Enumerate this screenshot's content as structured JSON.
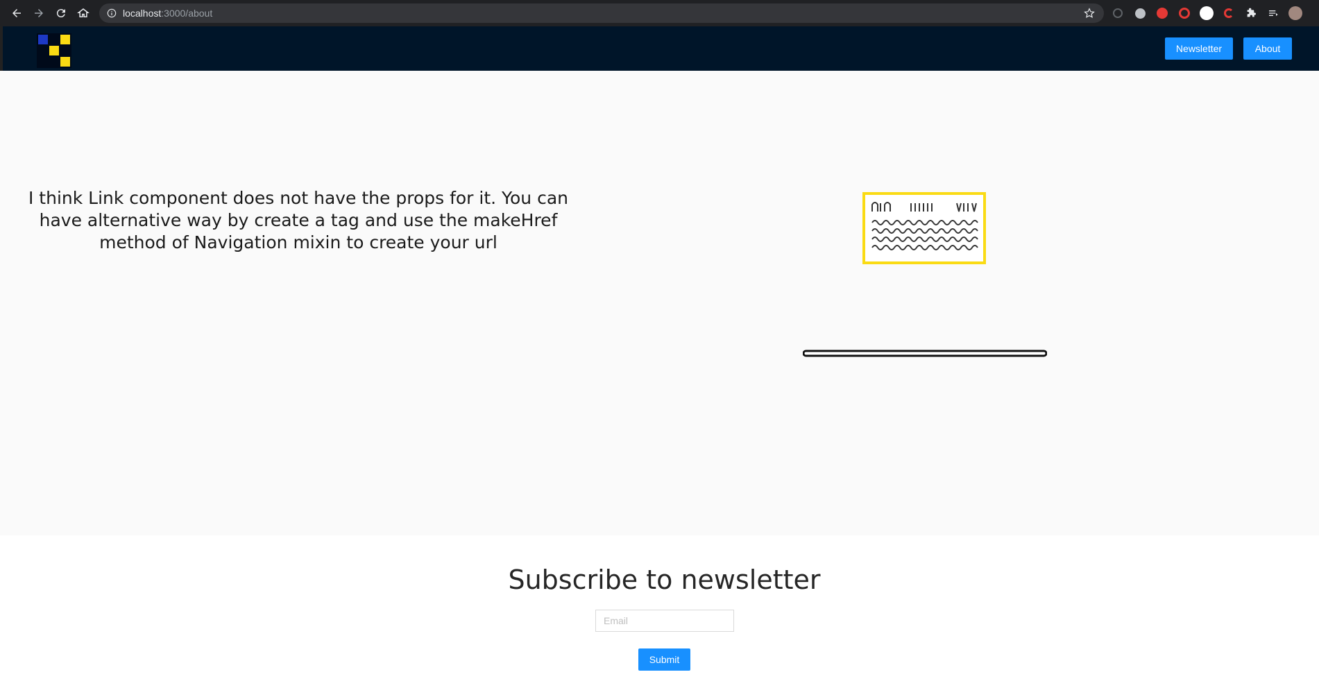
{
  "browser": {
    "url_host": "localhost",
    "url_path": ":3000/about"
  },
  "header": {
    "logo": "site-logo",
    "nav": [
      {
        "label": "Newsletter"
      },
      {
        "label": "About"
      }
    ],
    "colors": {
      "background": "#001529",
      "button": "#1890ff"
    }
  },
  "hero": {
    "text": "I think Link component does not have the props for it. You can have alternative way by create a tag and use the makeHref method of Navigation mixin to create your url",
    "illustration": "laptop-with-code-screen"
  },
  "newsletter": {
    "title": "Subscribe to newsletter",
    "email_placeholder": "Email",
    "submit_label": "Submit"
  }
}
